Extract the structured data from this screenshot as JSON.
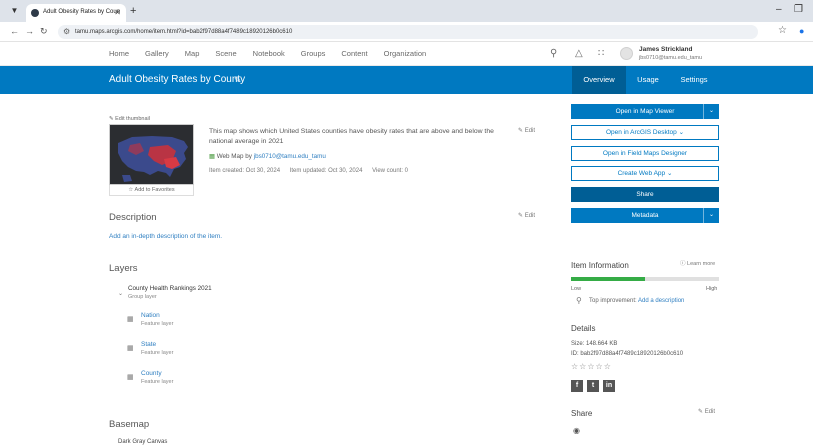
{
  "browser": {
    "tab_title": "Adult Obesity Rates by Coun",
    "url": "tamu.maps.arcgis.com/home/item.html?id=bab2f97d88a4f7489c18920126b0c610"
  },
  "header": {
    "nav": [
      "Home",
      "Gallery",
      "Map",
      "Scene",
      "Notebook",
      "Groups",
      "Content",
      "Organization"
    ],
    "user_name": "James Strickland",
    "user_id": "jbs0710@tamu.edu_tamu"
  },
  "title_band": {
    "title": "Adult Obesity Rates by County",
    "tabs": [
      "Overview",
      "Usage",
      "Settings"
    ]
  },
  "item": {
    "edit_thumbnail": "Edit thumbnail",
    "add_favorites": "Add to Favorites",
    "summary": "This map shows which United States counties have obesity rates that are above and below the national average in 2021",
    "edit_label": "Edit",
    "owner_prefix": "Web Map by",
    "owner": "jbs0710@tamu.edu_tamu",
    "created": "Item created: Oct 30, 2024",
    "updated": "Item updated: Oct 30, 2024",
    "views": "View count: 0"
  },
  "description": {
    "title": "Description",
    "link": "Add an in-depth description of the item."
  },
  "layers": {
    "title": "Layers",
    "group": {
      "name": "County Health Rankings 2021",
      "type": "Group layer"
    },
    "items": [
      {
        "name": "Nation",
        "type": "Feature layer"
      },
      {
        "name": "State",
        "type": "Feature layer"
      },
      {
        "name": "County",
        "type": "Feature layer"
      }
    ]
  },
  "basemap": {
    "title": "Basemap",
    "name": "Dark Gray Canvas"
  },
  "actions": {
    "open_map_viewer": "Open in Map Viewer",
    "open_arcgis_desktop": "Open in ArcGIS Desktop",
    "open_field_maps": "Open in Field Maps Designer",
    "create_web_app": "Create Web App",
    "share": "Share",
    "metadata": "Metadata"
  },
  "item_info": {
    "title": "Item Information",
    "learn_more": "Learn more",
    "low": "Low",
    "high": "High",
    "progress": 0.5,
    "improve_label": "Top improvement:",
    "improve_link": "Add a description"
  },
  "details": {
    "title": "Details",
    "size": "Size: 148.664 KB",
    "id": "ID: bab2f97d88a4f7489c18920126b0c610",
    "social": [
      "f",
      "t",
      "in"
    ]
  },
  "share_section": {
    "title": "Share",
    "edit": "Edit"
  },
  "colors": {
    "brand_blue": "#0079c1",
    "brand_dark": "#005e95",
    "progress_green": "#35ac46"
  }
}
